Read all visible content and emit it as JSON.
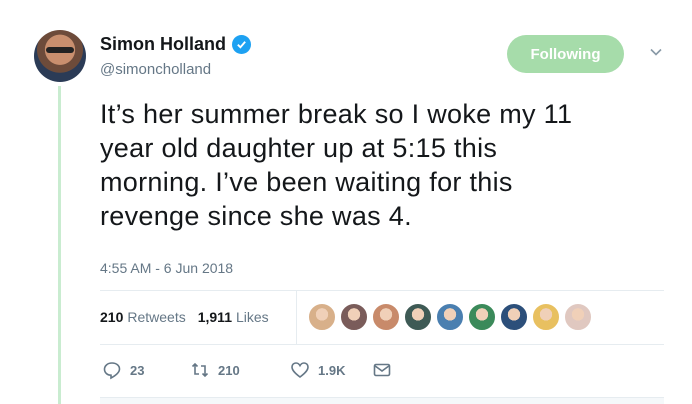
{
  "user": {
    "name": "Simon Holland",
    "handle": "@simoncholland",
    "verified": true
  },
  "follow_button": {
    "label": "Following",
    "color": "#a6dcaa"
  },
  "tweet": {
    "lines": [
      "It’s her summer break so I woke my 11",
      "year old daughter up at 5:15 this",
      "morning. I’ve been waiting for this",
      "revenge since she was 4."
    ],
    "timestamp": "4:55 AM - 6 Jun 2018"
  },
  "stats": {
    "retweets_count": "210",
    "retweets_label": "Retweets",
    "likes_count": "1,911",
    "likes_label": "Likes"
  },
  "liker_avatars": [
    "#d8b08a",
    "#7a5c5a",
    "#c88a6a",
    "#3e5a55",
    "#4a7fb0",
    "#3b8a5a",
    "#2c4f7a",
    "#e8c060",
    "#e0c8c0"
  ],
  "actions": {
    "reply_count": "23",
    "retweet_count": "210",
    "like_count": "1.9K"
  },
  "colors": {
    "accent": "#1da1f2",
    "muted": "#657786",
    "text": "#14171a"
  }
}
